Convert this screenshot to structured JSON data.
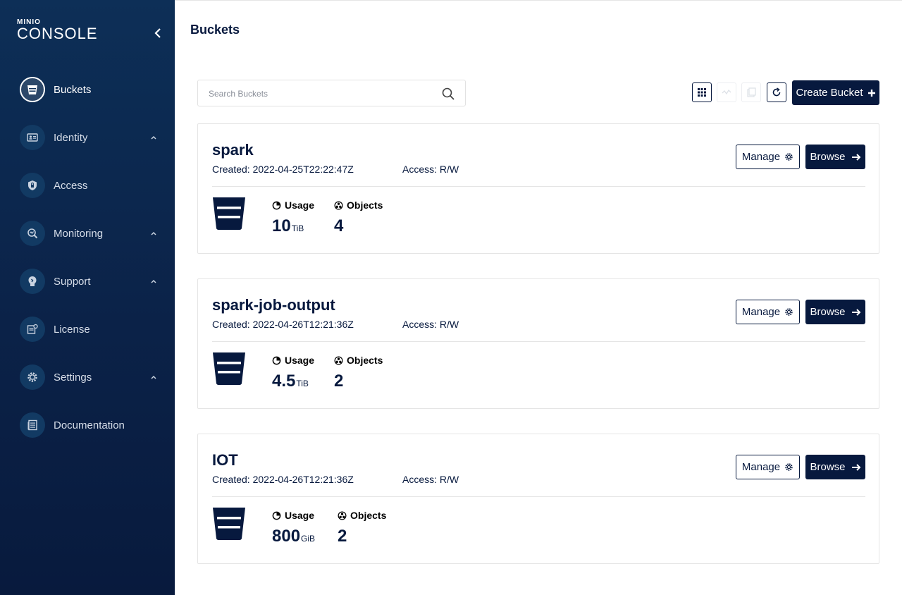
{
  "app": {
    "logo_top": "MINIO",
    "logo_main": "CONSOLE"
  },
  "sidebar": {
    "items": [
      {
        "label": "Buckets",
        "icon": "bucket-icon",
        "active": true,
        "expandable": false
      },
      {
        "label": "Identity",
        "icon": "id-card-icon",
        "active": false,
        "expandable": true
      },
      {
        "label": "Access",
        "icon": "lock-icon",
        "active": false,
        "expandable": false
      },
      {
        "label": "Monitoring",
        "icon": "monitor-search-icon",
        "active": false,
        "expandable": true
      },
      {
        "label": "Support",
        "icon": "support-icon",
        "active": false,
        "expandable": true
      },
      {
        "label": "License",
        "icon": "license-icon",
        "active": false,
        "expandable": false
      },
      {
        "label": "Settings",
        "icon": "gear-icon",
        "active": false,
        "expandable": true
      },
      {
        "label": "Documentation",
        "icon": "document-icon",
        "active": false,
        "expandable": false
      }
    ]
  },
  "header": {
    "title": "Buckets"
  },
  "search": {
    "placeholder": "Search Buckets",
    "value": ""
  },
  "toolbar": {
    "create_label": "Create Bucket"
  },
  "buckets": [
    {
      "name": "spark",
      "created": "Created: 2022-04-25T22:22:47Z",
      "access": "Access: R/W",
      "usage_label": "Usage",
      "usage_value": "10",
      "usage_unit": "TiB",
      "objects_label": "Objects",
      "objects_value": "4",
      "manage_label": "Manage",
      "browse_label": "Browse"
    },
    {
      "name": "spark-job-output",
      "created": "Created: 2022-04-26T12:21:36Z",
      "access": "Access: R/W",
      "usage_label": "Usage",
      "usage_value": "4.5",
      "usage_unit": "TiB",
      "objects_label": "Objects",
      "objects_value": "2",
      "manage_label": "Manage",
      "browse_label": "Browse"
    },
    {
      "name": "IOT",
      "created": "Created: 2022-04-26T12:21:36Z",
      "access": "Access: R/W",
      "usage_label": "Usage",
      "usage_value": "800",
      "usage_unit": "GiB",
      "objects_label": "Objects",
      "objects_value": "2",
      "manage_label": "Manage",
      "browse_label": "Browse"
    }
  ],
  "colors": {
    "brand": "#07193e",
    "sidebar_top": "#0d2f57",
    "sidebar_bottom": "#081a3d"
  }
}
